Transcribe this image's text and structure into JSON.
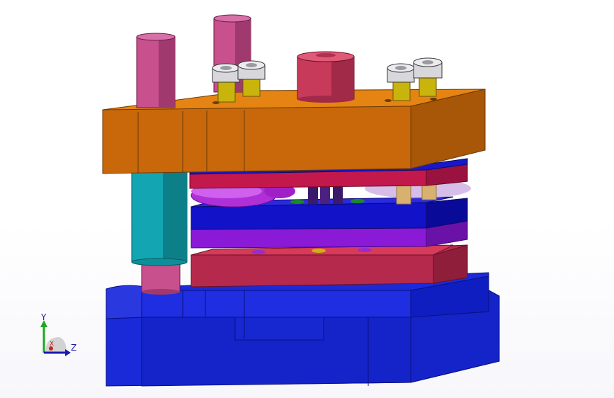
{
  "viewport": {
    "title": "",
    "background": "#ffffff"
  },
  "triad": {
    "y_label": "Y",
    "z_label": "Z",
    "x_label": "X"
  },
  "colors": {
    "top_plate": "#c8680a",
    "top_plate_side": "#a85608",
    "top_plate_top": "#e58412",
    "pin": "#c8508c",
    "pin_dark": "#a03a6e",
    "cyan_post": "#13a6b2",
    "cyan_post_dark": "#0d7f89",
    "red_plate": "#c2184c",
    "blue_plate": "#1212c8",
    "blue_plate_dark": "#0a0a90",
    "purple_plate": "#8a1ad6",
    "pink_plate": "#b52a4c",
    "pink_plate_top": "#d83a5a",
    "base": "#1a2ad8",
    "base_dark": "#1020a8",
    "bolt": "#c8b40c",
    "nut": "#c8c8cc",
    "center_cyl": "#c83a5a"
  }
}
